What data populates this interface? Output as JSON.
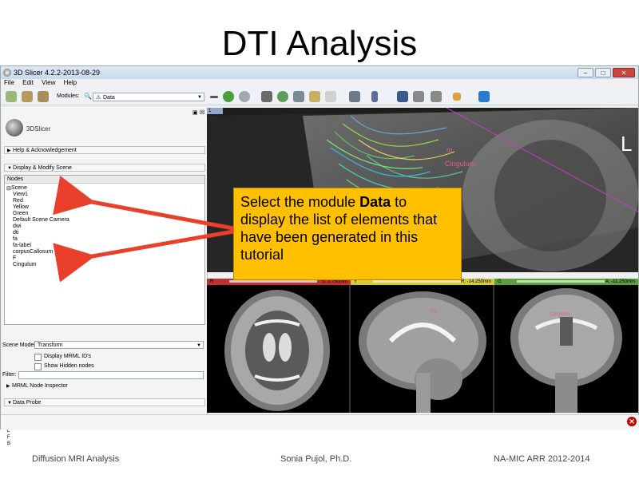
{
  "slide": {
    "title": "DTI Analysis",
    "footer_left": "Diffusion MRI Analysis",
    "footer_center": "Sonia Pujol, Ph.D.",
    "footer_right": "NA-MIC ARR 2012-2014"
  },
  "window": {
    "title": "3D Slicer 4.2.2-2013-08-29",
    "menu": [
      "File",
      "Edit",
      "View",
      "Help"
    ],
    "modules_label": "Modules:",
    "modules_selected": "Data"
  },
  "left_panel": {
    "logo_text": "3DSlicer",
    "help_section": "Help & Acknowledgement",
    "display_section": "Display & Modify Scene",
    "nodes_header": "Nodes",
    "tree_root": "Scene",
    "nodes": [
      "View1",
      "Red",
      "Yellow",
      "Green",
      "Default Scene Camera",
      "dwi",
      "dti",
      "fa",
      "fa-label",
      "corpusCallosum",
      "F",
      "Cingulum"
    ],
    "scene_model_label": "Scene Model:",
    "scene_model_value": "Transform",
    "display_mrml_ids": "Display MRML ID's",
    "show_hidden_nodes": "Show Hidden nodes",
    "filter_label": "Filter:",
    "mrml_inspector": "MRML Node Inspector",
    "data_probe": "Data Probe",
    "probe_lines": [
      "L",
      "F",
      "B"
    ]
  },
  "view_3d": {
    "tab": "1",
    "label_cingulum": "Cingulum",
    "label_m": "m",
    "orientation_letter": "L"
  },
  "slices": {
    "red": {
      "letter": "R",
      "value": "S: 3.750mm",
      "color": "#c03030"
    },
    "yellow": {
      "letter": "Y",
      "value": "R: -14.250mm",
      "color": "#d8c840"
    },
    "green": {
      "letter": "G",
      "value": "A: -11.250mm",
      "color": "#5aa040"
    }
  },
  "callout": {
    "pre": "Select the module ",
    "bold": "Data",
    "post": " to display the list of elements that have been generated in this tutorial"
  },
  "colors": {
    "callout_bg": "#ffc000",
    "arrow": "#e8402a"
  }
}
